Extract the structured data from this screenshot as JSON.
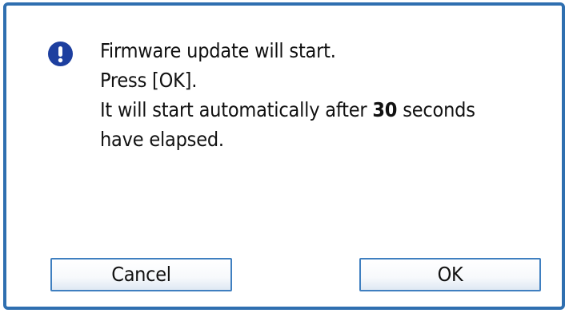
{
  "dialog": {
    "icon": "exclamation-icon",
    "accent_color": "#2f6fb0",
    "icon_color": "#1d3f9f",
    "message": {
      "line1": "Firmware update will start.",
      "line2": "Press [OK].",
      "line3_prefix": "It will start automatically after ",
      "countdown_seconds": "30",
      "line3_suffix": " seconds",
      "line4": "have elapsed."
    },
    "buttons": {
      "cancel_label": "Cancel",
      "ok_label": "OK"
    }
  }
}
